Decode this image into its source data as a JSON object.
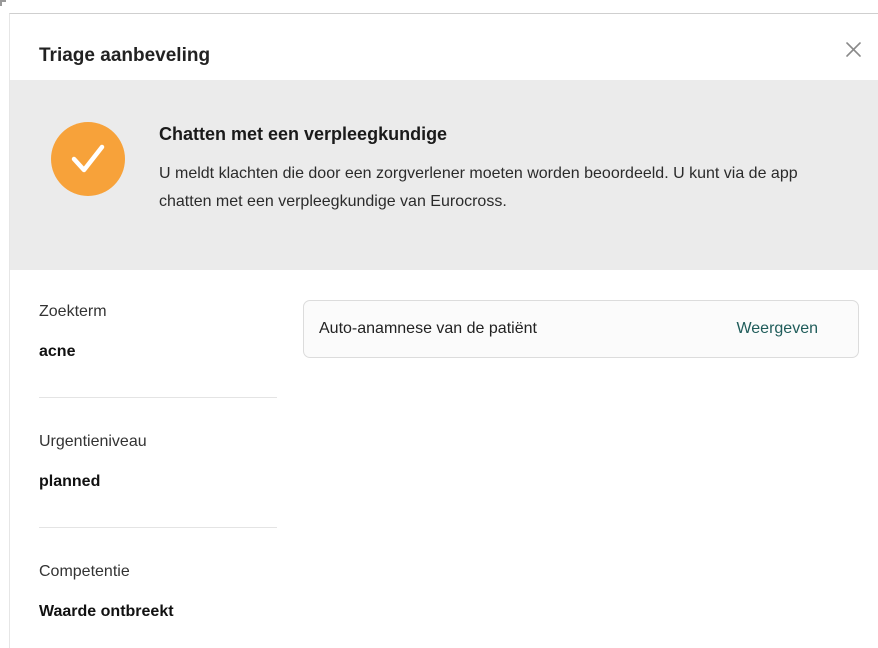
{
  "dialog": {
    "title": "Triage aanbeveling",
    "close_icon": "close-icon"
  },
  "banner": {
    "icon": "check-circle-icon",
    "icon_color": "#f7a23a",
    "background": "#ebebeb",
    "title": "Chatten met een verpleegkundige",
    "text": "U meldt klachten die door een zorgverlener moeten worden beoordeeld. U kunt via de app chatten met een verpleegkundige van Eurocross."
  },
  "fields": [
    {
      "label": "Zoekterm",
      "value": "acne"
    },
    {
      "label": "Urgentieniveau",
      "value": "planned"
    },
    {
      "label": "Competentie",
      "value": "Waarde ontbreekt"
    }
  ],
  "anamnese": {
    "label": "Auto-anamnese van de patiënt",
    "link": "Weergeven",
    "link_color": "#1f5c5a"
  }
}
